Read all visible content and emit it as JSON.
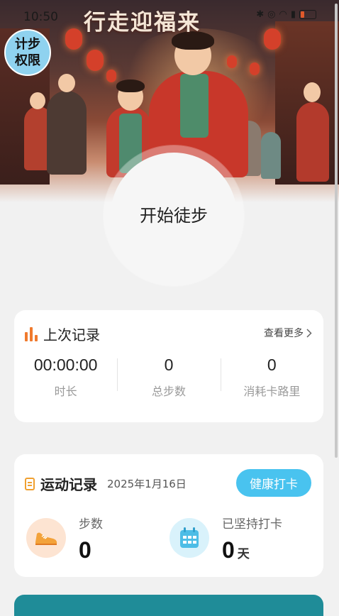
{
  "status_bar": {
    "time": "10:50",
    "icons": [
      "bluetooth-icon",
      "sound-icon",
      "wifi-icon",
      "sim-icon",
      "battery-icon"
    ]
  },
  "hero": {
    "title": "行走迎福来"
  },
  "permission_badge": {
    "label": "计步权限"
  },
  "start": {
    "label": "开始徒步"
  },
  "last_record": {
    "title": "上次记录",
    "see_more": "查看更多",
    "stats": [
      {
        "value": "00:00:00",
        "label": "时长"
      },
      {
        "value": "0",
        "label": "总步数"
      },
      {
        "value": "0",
        "label": "消耗卡路里"
      }
    ]
  },
  "exercise_record": {
    "title": "运动记录",
    "date": "2025年1月16日",
    "checkin_button": "健康打卡",
    "steps_label": "步数",
    "steps_value": "0",
    "streak_label": "已坚持打卡",
    "streak_value": "0",
    "streak_unit": "天"
  },
  "colors": {
    "accent_orange": "#f07a2d",
    "accent_blue": "#49c3ef",
    "bottom_button": "#1f8c98"
  }
}
